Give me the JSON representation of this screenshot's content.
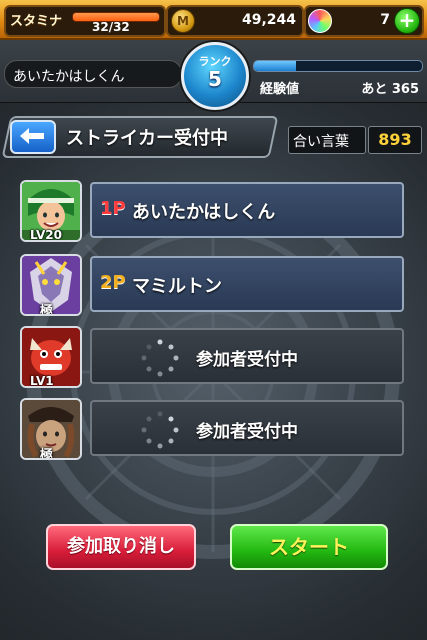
{
  "status": {
    "stamina_label": "スタミナ",
    "stamina_value": "32/32",
    "stamina_fill": 1.0,
    "coins": "49,244",
    "coin_icon_glyph": "M",
    "orbs": "7",
    "add_orbs_glyph": "+"
  },
  "user": {
    "name": "あいたかはしくん",
    "rank_label": "ランク",
    "rank": "5",
    "exp_label": "経験値",
    "exp_remaining": "あと 365",
    "exp_fill": 0.25
  },
  "header": {
    "title": "ストライカー受付中",
    "password_label": "合い言葉",
    "password_value": "893"
  },
  "slots": [
    {
      "number": "1P",
      "name": "あいたかはしくん",
      "avatar_badge": "LV20",
      "filled": true
    },
    {
      "number": "2P",
      "name": "マミルトン",
      "avatar_badge": "極",
      "filled": true
    },
    {
      "waiting_text": "参加者受付中",
      "avatar_badge": "LV1",
      "filled": false
    },
    {
      "waiting_text": "参加者受付中",
      "avatar_badge": "極",
      "filled": false
    }
  ],
  "buttons": {
    "cancel": "参加取り消し",
    "start": "スタート"
  },
  "colors": {
    "accent_orange": "#e08b12",
    "rank_blue": "#1d86cc",
    "password_yellow": "#ffd23a",
    "cancel_red": "#d81d3a",
    "start_green": "#23b812"
  }
}
